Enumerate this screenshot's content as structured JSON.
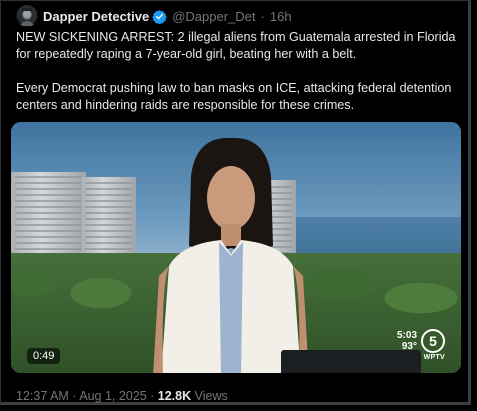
{
  "author": {
    "name": "Dapper Detective",
    "handle": "@Dapper_Det",
    "separator": "·",
    "age": "16h"
  },
  "tweet": {
    "paragraph1": "NEW SICKENING ARREST: 2 illegal aliens from Guatemala arrested in Florida for repeatedly raping a 7-year-old girl, beating her with a belt.",
    "paragraph2": "Every Democrat pushing law to ban masks on ICE, attacking federal detention centers and hindering raids are responsible for these crimes."
  },
  "video": {
    "duration": "0:49",
    "bug_time": "5:03",
    "bug_temp": "93°",
    "channel_number": "5",
    "channel_name": "WPTV"
  },
  "meta": {
    "time": "12:37 AM",
    "dot1": " · ",
    "date": "Aug 1, 2025",
    "dot2": " · ",
    "views_count": "12.8K",
    "views_label": " Views"
  },
  "colors": {
    "verified": "#1d9bf0",
    "text": "#e7e9ea",
    "muted": "#71767b"
  }
}
